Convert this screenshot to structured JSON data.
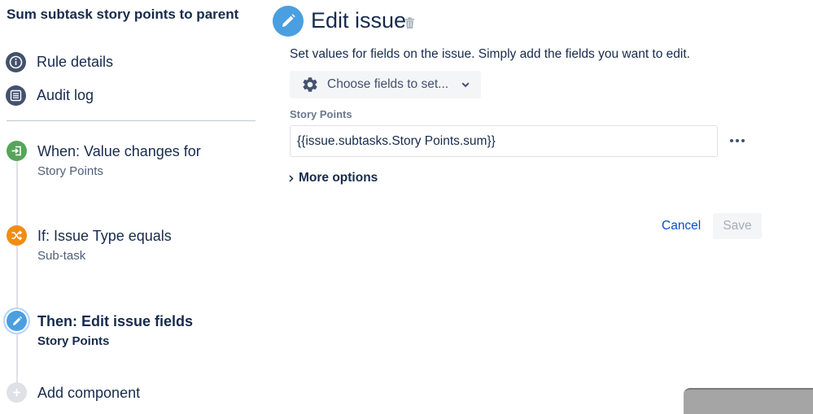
{
  "rule": {
    "title": "Sum subtask story points to parent"
  },
  "nav": {
    "items": [
      {
        "label": "Rule details",
        "icon": "info-icon"
      },
      {
        "label": "Audit log",
        "icon": "list-icon"
      }
    ]
  },
  "steps": [
    {
      "title": "When: Value changes for",
      "subtitle": "Story Points",
      "icon": "trigger-icon",
      "color": "#57a55a"
    },
    {
      "title": "If: Issue Type equals",
      "subtitle": "Sub-task",
      "icon": "shuffle-icon",
      "color": "#f18d13"
    },
    {
      "title": "Then: Edit issue fields",
      "subtitle": "Story Points",
      "icon": "pencil-icon",
      "color": "#4a9fe0"
    }
  ],
  "add_component": {
    "label": "Add component",
    "icon": "plus-icon",
    "color": "#dfe1e6"
  },
  "editor": {
    "title": "Edit issue",
    "description": "Set values for fields on the issue. Simply add the fields you want to edit.",
    "choose_fields_label": "Choose fields to set...",
    "field": {
      "label": "Story Points",
      "value": "{{issue.subtasks.Story Points.sum}}"
    },
    "more_options_label": "More options",
    "cancel_label": "Cancel",
    "save_label": "Save"
  },
  "colors": {
    "accent": "#4a9fe0",
    "link": "#0052cc",
    "text": "#172b4d",
    "trigger": "#57a55a",
    "condition": "#f18d13"
  }
}
